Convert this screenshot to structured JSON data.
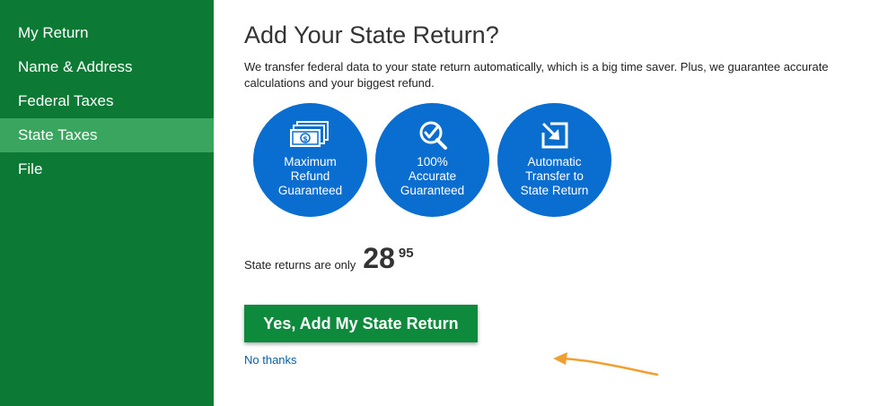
{
  "sidebar": {
    "items": [
      {
        "label": "My Return"
      },
      {
        "label": "Name & Address"
      },
      {
        "label": "Federal Taxes"
      },
      {
        "label": "State Taxes",
        "active": true
      },
      {
        "label": "File"
      }
    ]
  },
  "main": {
    "title": "Add Your State Return?",
    "description": "We transfer federal data to your state return automatically, which is a big time saver. Plus, we guarantee accurate calculations and your biggest refund.",
    "badges": [
      {
        "icon": "money-bills-icon",
        "lines": [
          "Maximum",
          "Refund",
          "Guaranteed"
        ]
      },
      {
        "icon": "magnifier-check-icon",
        "lines": [
          "100%",
          "Accurate",
          "Guaranteed"
        ]
      },
      {
        "icon": "transfer-arrow-icon",
        "lines": [
          "Automatic",
          "Transfer to",
          "State Return"
        ]
      }
    ],
    "price": {
      "label": "State returns are only",
      "dollars": "28",
      "cents": "95"
    },
    "cta_label": "Yes, Add My State Return",
    "decline_label": "No thanks"
  },
  "colors": {
    "sidebar_bg": "#0c7a35",
    "sidebar_active": "#3aa55f",
    "badge_blue": "#0a6ed1",
    "cta_green": "#0d8a3c",
    "link_blue": "#0a5fa8",
    "annotation_arrow": "#f0a030"
  }
}
